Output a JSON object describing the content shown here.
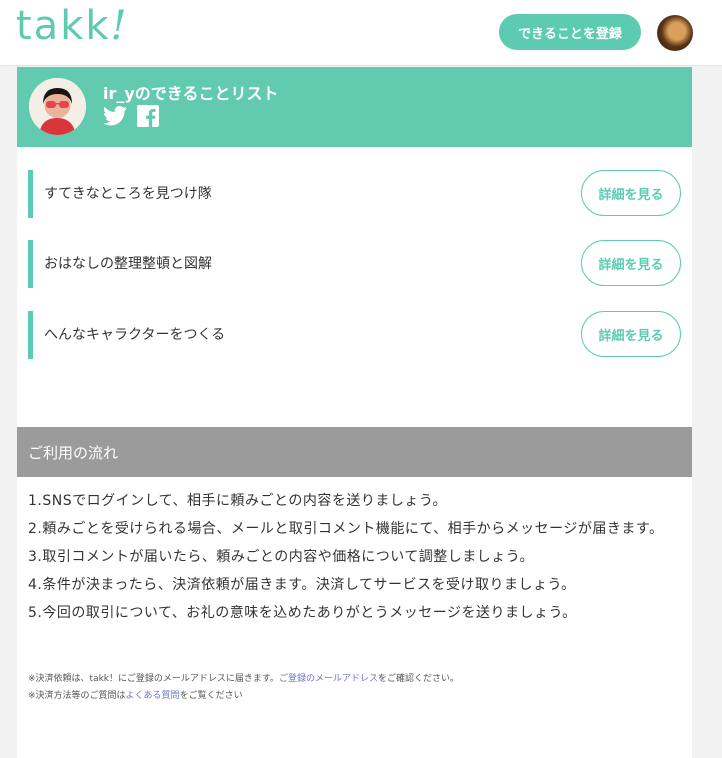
{
  "header": {
    "logo": "takk",
    "logo_mark": "!",
    "register_button": "できることを登録"
  },
  "profile": {
    "title": "ir_yのできることリスト"
  },
  "skills": [
    {
      "title": "すてきなところを見つけ隊",
      "button": "詳細を見る"
    },
    {
      "title": "おはなしの整理整頓と図解",
      "button": "詳細を見る"
    },
    {
      "title": "へんなキャラクターをつくる",
      "button": "詳細を見る"
    }
  ],
  "flow": {
    "heading": "ご利用の流れ",
    "steps": [
      "1.SNSでログインして、相手に頼みごとの内容を送りましょう。",
      "2.頼みごとを受けられる場合、メールと取引コメント機能にて、相手からメッセージが届きます。",
      "3.取引コメントが届いたら、頼みごとの内容や価格について調整しましょう。",
      "4.条件が決まったら、決済依頼が届きます。決済してサービスを受け取りましょう。",
      "5.今回の取引について、お礼の意味を込めたありがとうメッセージを送りましょう。"
    ],
    "note1_prefix": "※決済依頼は、takk！にご登録のメールアドレスに届きます。",
    "note1_link": "ご登録のメールアドレス",
    "note1_suffix": "をご確認ください。",
    "note2_prefix": "※決済方法等のご質問は",
    "note2_link": "よくある質問",
    "note2_suffix": "をご覧ください"
  },
  "colors": {
    "brand": "#5ccbb2",
    "profile_bg": "#62cbaf",
    "flow_header_bg": "#9b9b9b",
    "link": "#6b74c9"
  }
}
